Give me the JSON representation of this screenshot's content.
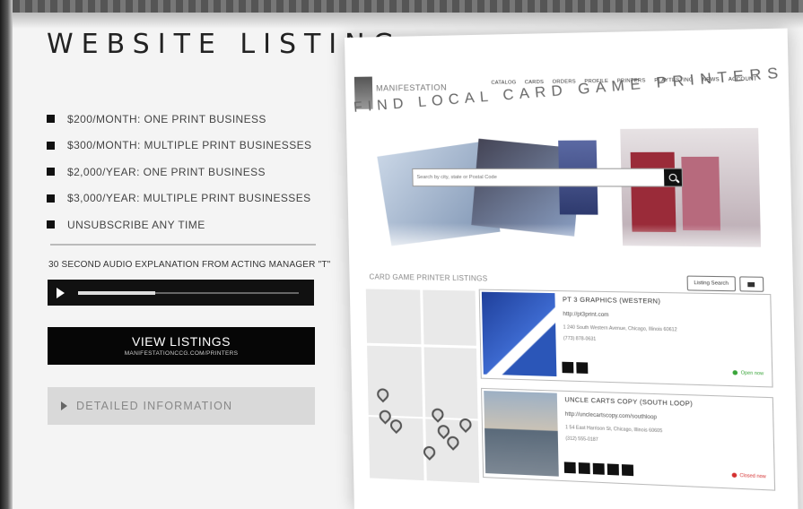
{
  "header": {
    "title": "WEBSITE LISTING"
  },
  "pricing": {
    "items": [
      {
        "label": "$200/MONTH: ONE PRINT BUSINESS"
      },
      {
        "label": "$300/MONTH: MULTIPLE PRINT BUSINESSES"
      },
      {
        "label": "$2,000/YEAR: ONE PRINT BUSINESS"
      },
      {
        "label": "$3,000/YEAR: MULTIPLE PRINT BUSINESSES"
      },
      {
        "label": "UNSUBSCRIBE ANY TIME"
      }
    ]
  },
  "audio": {
    "label": "30 SECOND AUDIO EXPLANATION FROM ACTING MANAGER \"T\"",
    "progress": 0.35
  },
  "view_listings": {
    "label": "VIEW LISTINGS",
    "sublabel": "MANIFESTATIONCCG.COM/PRINTERS"
  },
  "details": {
    "label": "DETAILED INFORMATION"
  },
  "screenshot": {
    "logo_text": "MANIFESTATION",
    "nav": [
      "CATALOG",
      "CARDS",
      "ORDERS",
      "PROFILE",
      "PRINTERS",
      "PLAYTESTING",
      "NEWS",
      "ACCOUNT"
    ],
    "headline": "FIND LOCAL CARD GAME PRINTERS",
    "search_placeholder": "Search by city, state or Postal Code",
    "section_title": "CARD GAME PRINTER LISTINGS",
    "sort_label": "Listing Search",
    "listings": [
      {
        "name": "PT 3 GRAPHICS (WESTERN)",
        "url": "http://pt3print.com",
        "address": "1 240 South Western Avenue, Chicago, Illinois 60612",
        "phone": "(773) 878-0631",
        "status": "Open now",
        "status_color": "#3aa53a"
      },
      {
        "name": "UNCLE CARTS COPY (SOUTH LOOP)",
        "url": "http://unclecartscopy.com/southloop",
        "address": "1 54 East Harrison St, Chicago, Illinois 60605",
        "phone": "(312) 555-0187",
        "status": "Closed now",
        "status_color": "#d43030"
      }
    ]
  }
}
